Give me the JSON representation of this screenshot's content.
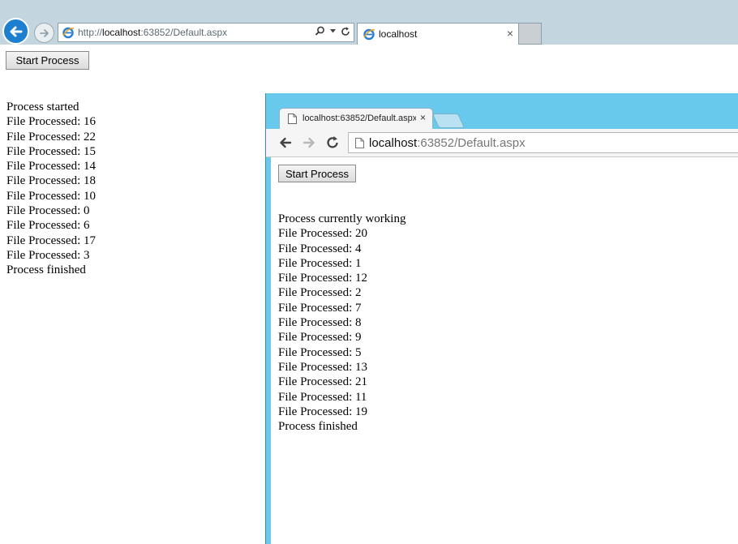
{
  "ie": {
    "address": {
      "url_prefix": "http://",
      "url_host": "localhost",
      "url_rest": ":63852/Default.aspx"
    },
    "tab": {
      "title": "localhost",
      "close": "×"
    },
    "start_button": "Start Process",
    "log": [
      "Process started",
      "File Processed: 16",
      "File Processed: 22",
      "File Processed: 15",
      "File Processed: 14",
      "File Processed: 18",
      "File Processed: 10",
      "File Processed: 0",
      "File Processed: 6",
      "File Processed: 17",
      "File Processed: 3",
      "Process finished"
    ]
  },
  "chrome": {
    "tab": {
      "title": "localhost:63852/Default.aspx",
      "close": "×"
    },
    "address": {
      "url_host": "localhost",
      "url_rest": ":63852/Default.aspx"
    },
    "start_button": "Start Process",
    "log": [
      "Process currently working",
      "File Processed: 20",
      "File Processed: 4",
      "File Processed: 1",
      "File Processed: 12",
      "File Processed: 2",
      "File Processed: 7",
      "File Processed: 8",
      "File Processed: 9",
      "File Processed: 5",
      "File Processed: 13",
      "File Processed: 21",
      "File Processed: 11",
      "File Processed: 19",
      "Process finished"
    ]
  },
  "icons": {
    "ie_back": "back-arrow-icon",
    "ie_forward": "forward-arrow-icon",
    "ie_logo": "ie-logo-icon",
    "search": "search-icon",
    "refresh": "refresh-icon",
    "page": "page-icon"
  },
  "colors": {
    "ie_frame": "#c3d6df",
    "ie_back": "#1e7ecf",
    "chrome_frame": "#68c9ec"
  }
}
